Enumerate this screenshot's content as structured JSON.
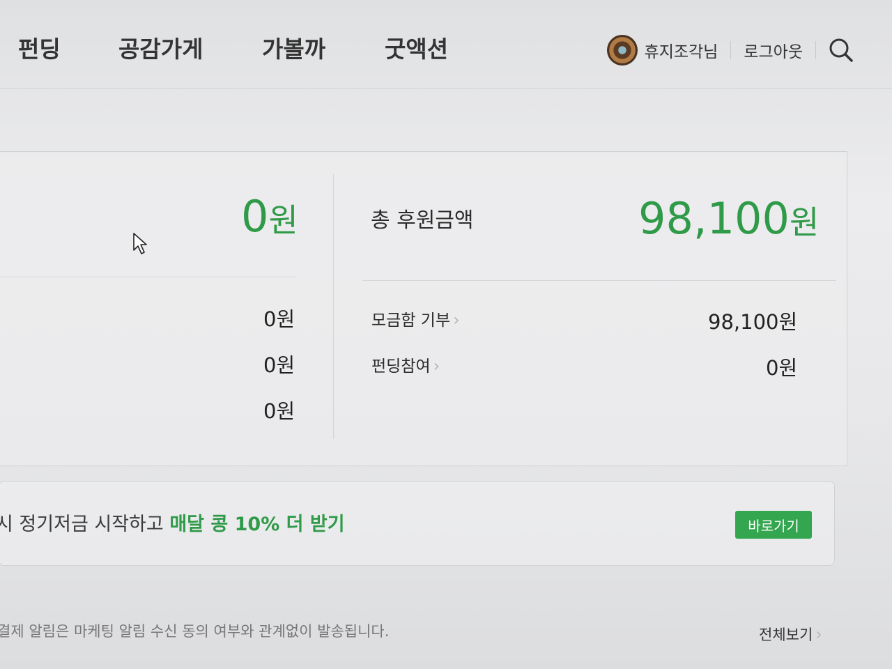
{
  "nav": {
    "items": [
      {
        "label": "펀딩"
      },
      {
        "label": "공감가게"
      },
      {
        "label": "가볼까"
      },
      {
        "label": "굿액션"
      }
    ],
    "user_name": "휴지조각님",
    "logout_label": "로그아웃"
  },
  "summary": {
    "left_total_value": "0",
    "left_total_unit": "원",
    "left_rows": [
      {
        "value": "0원"
      },
      {
        "value": "0원"
      },
      {
        "value": "0원"
      }
    ],
    "total_label": "총 후원금액",
    "total_value": "98,100",
    "total_unit": "원",
    "details": [
      {
        "label": "모금함 기부",
        "value": "98,100원"
      },
      {
        "label": "펀딩참여",
        "value": "0원"
      }
    ]
  },
  "promo": {
    "text_prefix": "시 정기저금 시작하고 ",
    "text_highlight": "매달 콩 10% 더 받기",
    "button_label": "바로가기"
  },
  "footer": {
    "notice": "결제 알림은 마케팅 알림 수신 동의 여부와 관계없이 발송됩니다.",
    "view_all_label": "전체보기"
  },
  "colors": {
    "accent": "#2f9a48",
    "button": "#33a64f"
  }
}
